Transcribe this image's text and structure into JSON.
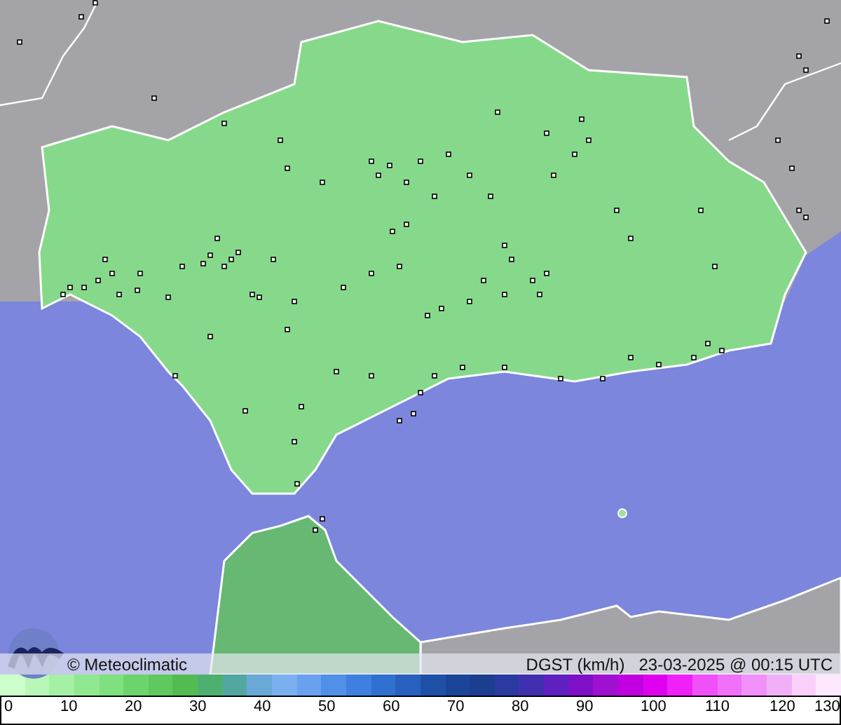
{
  "footer": {
    "credit": "© Meteoclimatic",
    "variable": "DGST (km/h)",
    "timestamp": "23-03-2025 @ 00:15 UTC"
  },
  "legend": {
    "ticks": [
      "0",
      "10",
      "20",
      "30",
      "40",
      "50",
      "60",
      "70",
      "80",
      "90",
      "100",
      "110",
      "120",
      "130"
    ]
  }
}
